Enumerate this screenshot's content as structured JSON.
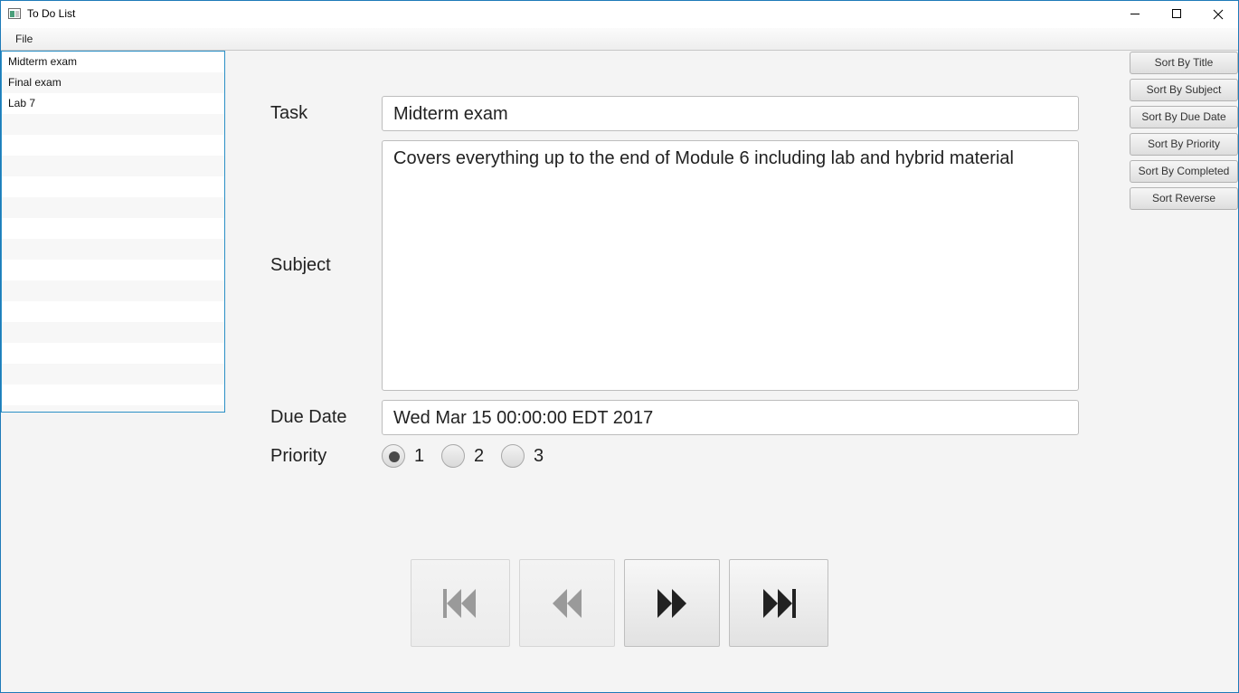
{
  "window": {
    "title": "To Do List"
  },
  "menu": {
    "file": "File"
  },
  "task_list": {
    "items": [
      "Midterm exam",
      "Final exam",
      "Lab 7"
    ]
  },
  "form": {
    "task_label": "Task",
    "task_value": "Midterm exam",
    "subject_label": "Subject",
    "subject_value": "Covers everything up to the end of Module 6 including lab and hybrid material",
    "due_date_label": "Due Date",
    "due_date_value": "Wed Mar 15 00:00:00 EDT 2017",
    "priority_label": "Priority",
    "priority_options": [
      "1",
      "2",
      "3"
    ],
    "priority_selected": "1"
  },
  "sort_buttons": {
    "title": "Sort By Title",
    "subject": "Sort By Subject",
    "due_date": "Sort By Due Date",
    "priority": "Sort By Priority",
    "completed": "Sort By Completed",
    "reverse": "Sort Reverse"
  },
  "navigation": {
    "first": {
      "icon": "first-icon",
      "enabled": false
    },
    "previous": {
      "icon": "previous-icon",
      "enabled": false
    },
    "next": {
      "icon": "next-icon",
      "enabled": true
    },
    "last": {
      "icon": "last-icon",
      "enabled": true
    }
  },
  "colors": {
    "accent": "#2c90c6",
    "background": "#f4f4f4"
  }
}
